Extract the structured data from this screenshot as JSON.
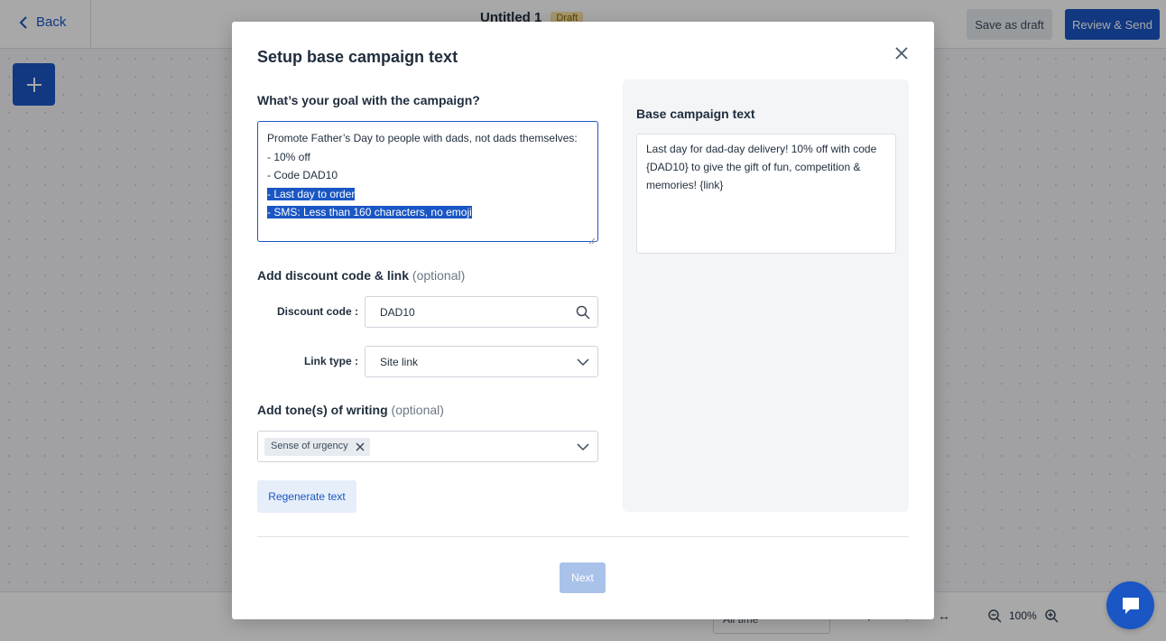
{
  "app": {
    "back_label": "Back",
    "doc_title": "Untitled 1",
    "status_badge": "Draft",
    "save_draft_label": "Save as draft",
    "review_send_label": "Review & Send",
    "time_filter": "All time",
    "zoom_level": "100%"
  },
  "modal": {
    "title": "Setup base campaign text",
    "goal": {
      "label": "What’s your goal with the campaign?",
      "lines": [
        "Promote Father’s Day to people with dads, not dads themselves:",
        "- 10% off",
        "- Code DAD10",
        "- Last day to order",
        "- SMS: Less than 160 characters, no emoji"
      ]
    },
    "discount": {
      "heading": "Add discount code & link",
      "optional": "(optional)",
      "code_label": "Discount code",
      "code_value": "DAD10",
      "link_label": "Link type",
      "link_value": "Site link"
    },
    "tone": {
      "heading": "Add tone(s) of writing",
      "optional": "(optional)",
      "chip": "Sense of urgency"
    },
    "regenerate_label": "Regenerate text",
    "base_text": {
      "title": "Base campaign text",
      "body": "Last day for dad-day delivery! 10% off with code {DAD10} to give the gift of fun, competition & memories! {link}"
    },
    "next_label": "Next"
  },
  "colors": {
    "accent": "#1a56c4",
    "draft_badge": "#fbe4a6",
    "next_disabled": "#a9c2ea"
  }
}
